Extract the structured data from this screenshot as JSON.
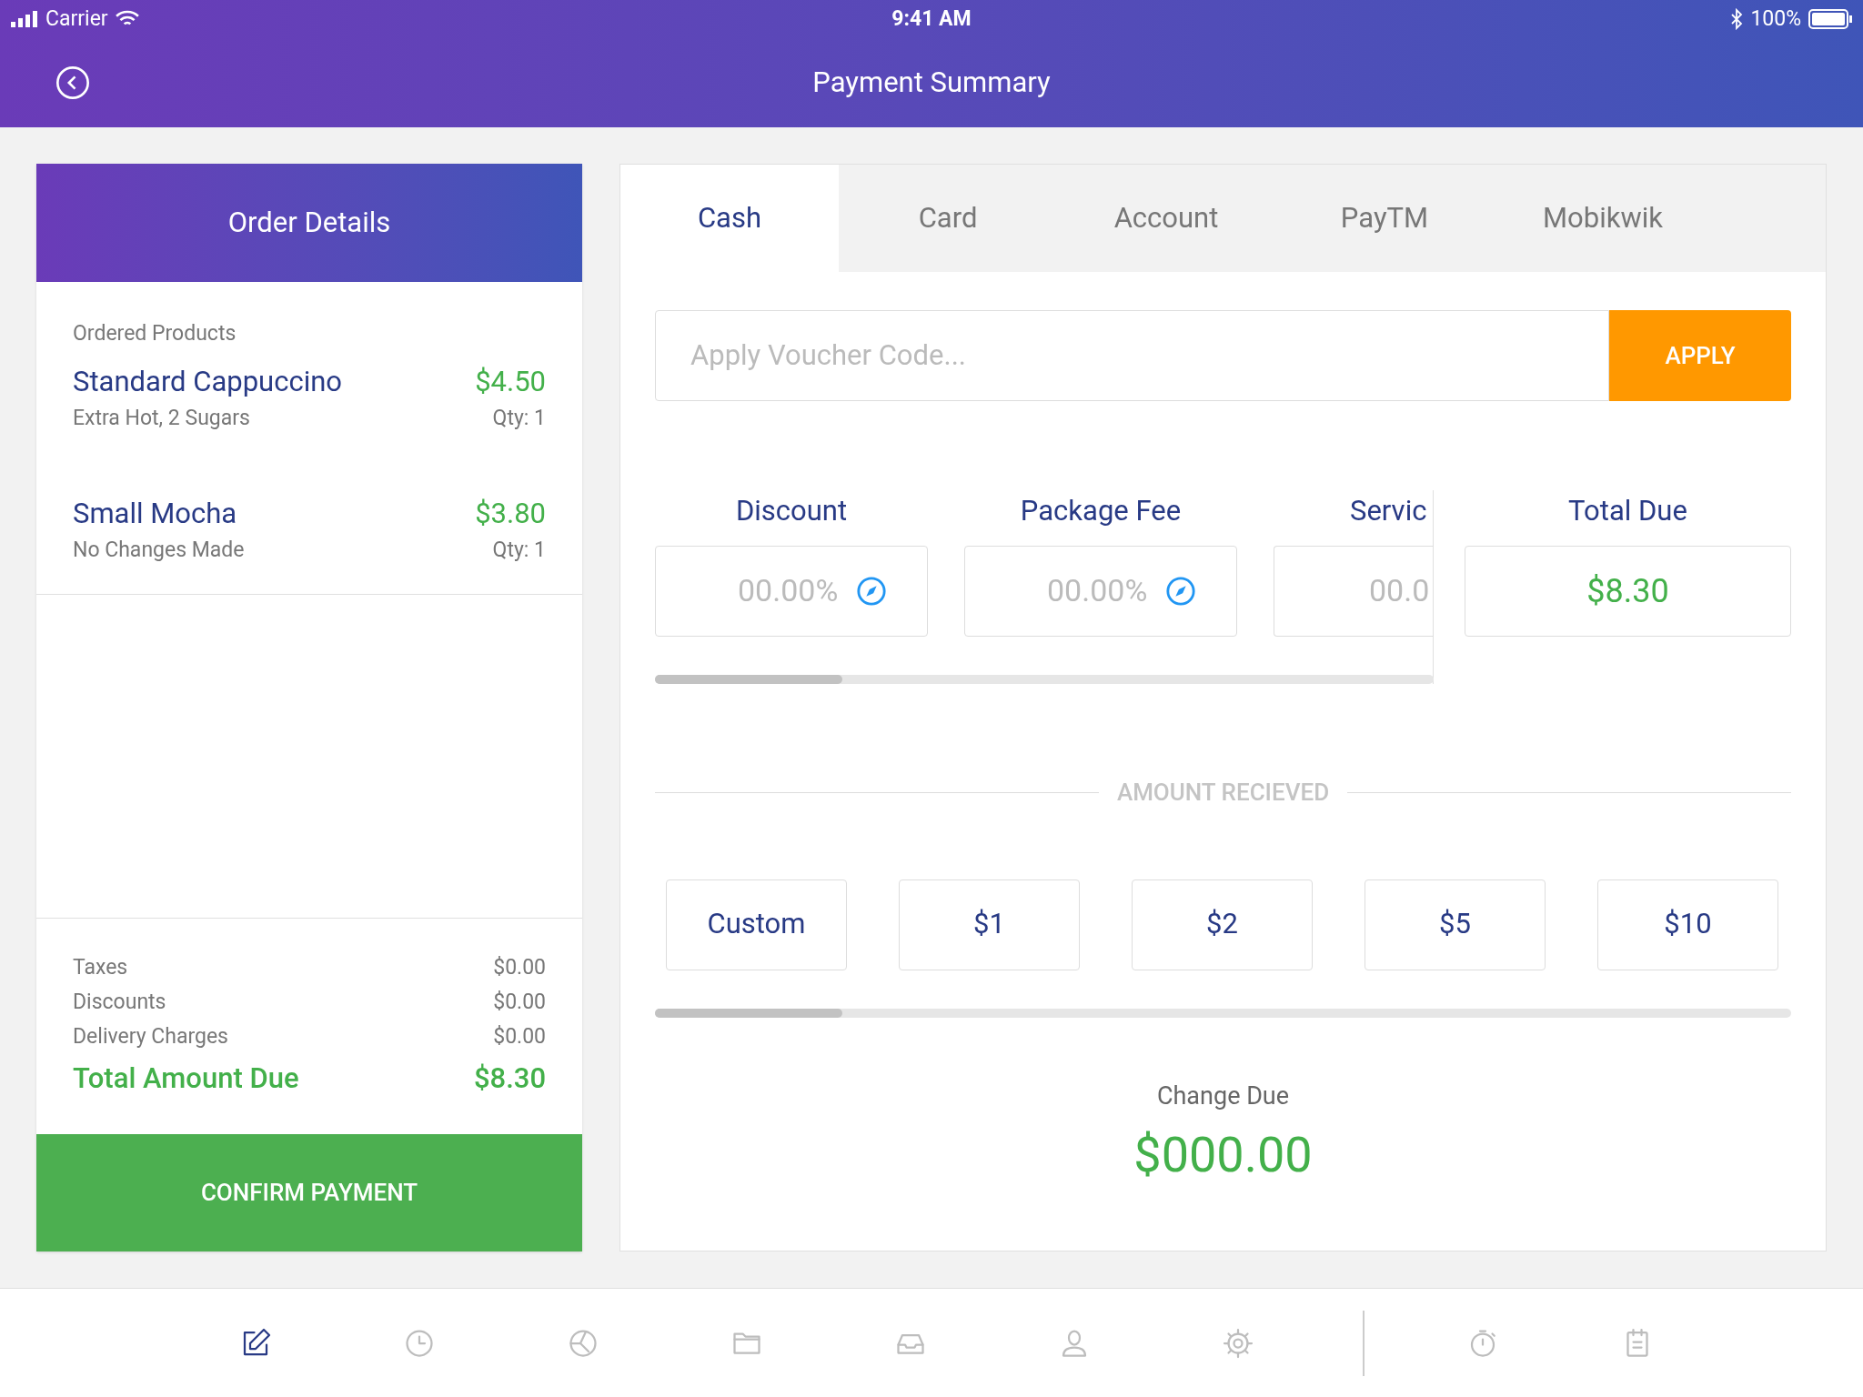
{
  "status_bar": {
    "carrier": "Carrier",
    "time": "9:41 AM",
    "battery": "100%"
  },
  "header": {
    "title": "Payment Summary"
  },
  "order": {
    "title": "Order Details",
    "section_label": "Ordered Products",
    "products": [
      {
        "name": "Standard Cappuccino",
        "price": "$4.50",
        "note": "Extra Hot, 2 Sugars",
        "qty": "Qty: 1"
      },
      {
        "name": "Small Mocha",
        "price": "$3.80",
        "note": "No Changes Made",
        "qty": "Qty: 1"
      }
    ],
    "summary": [
      {
        "label": "Taxes",
        "value": "$0.00"
      },
      {
        "label": "Discounts",
        "value": "$0.00"
      },
      {
        "label": "Delivery Charges",
        "value": "$0.00"
      }
    ],
    "total": {
      "label": "Total Amount Due",
      "value": "$8.30"
    },
    "confirm_button": "CONFIRM PAYMENT"
  },
  "tabs": [
    {
      "label": "Cash",
      "selected": true
    },
    {
      "label": "Card",
      "selected": false
    },
    {
      "label": "Account",
      "selected": false
    },
    {
      "label": "PayTM",
      "selected": false
    },
    {
      "label": "Mobikwik",
      "selected": false
    }
  ],
  "voucher": {
    "placeholder": "Apply Voucher Code...",
    "button": "APPLY"
  },
  "fees": [
    {
      "kind": "percent",
      "label": "Discount",
      "placeholder": "00.00%"
    },
    {
      "kind": "percent",
      "label": "Package Fee",
      "placeholder": "00.00%"
    },
    {
      "kind": "partial",
      "label": "Servic",
      "placeholder": "00.0"
    }
  ],
  "total_due": {
    "label": "Total Due",
    "value": "$8.30"
  },
  "amount_received": {
    "label": "AMOUNT RECIEVED",
    "options": [
      "Custom",
      "$1",
      "$2",
      "$5",
      "$10"
    ]
  },
  "change_due": {
    "label": "Change Due",
    "value": "$000.00"
  },
  "nav": {
    "main": [
      {
        "kind": "edit",
        "selected": true
      },
      {
        "kind": "clock",
        "selected": false
      },
      {
        "kind": "pie",
        "selected": false
      },
      {
        "kind": "folder",
        "selected": false
      },
      {
        "kind": "inbox",
        "selected": false
      },
      {
        "kind": "user",
        "selected": false
      },
      {
        "kind": "gear",
        "selected": false
      }
    ],
    "extra": [
      {
        "kind": "timer",
        "selected": false
      },
      {
        "kind": "clipboard",
        "selected": false
      }
    ]
  }
}
